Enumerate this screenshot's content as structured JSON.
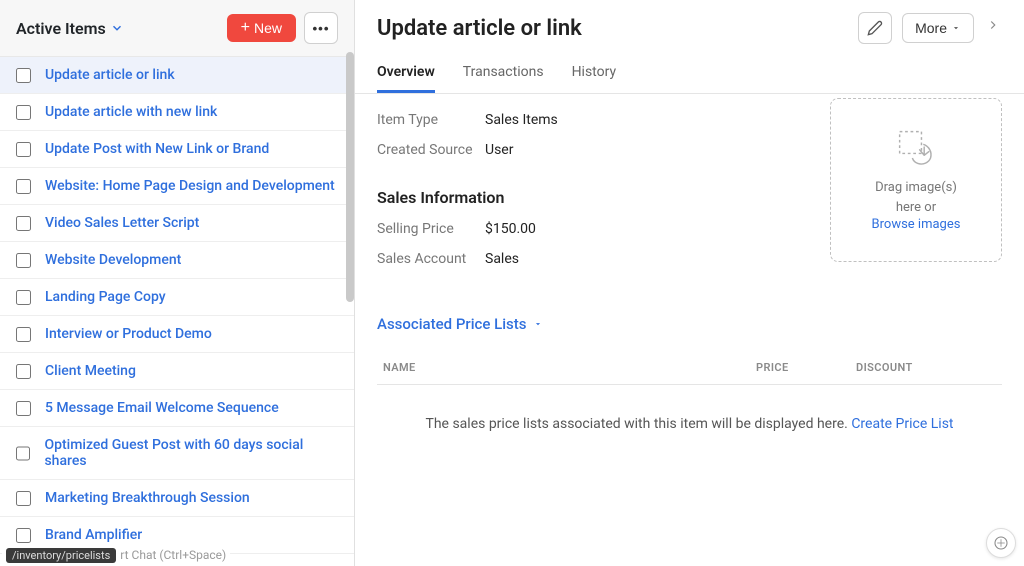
{
  "sidebar": {
    "filter_label": "Active Items",
    "new_button": "New",
    "items": [
      "Update article or link",
      "Update article with new link",
      "Update Post with New Link or Brand",
      "Website: Home Page Design and Development",
      "Video Sales Letter Script",
      "Website Development",
      "Landing Page Copy",
      "Interview or Product Demo",
      "Client Meeting",
      "5 Message Email Welcome Sequence",
      "Optimized Guest Post with 60 days social shares",
      "Marketing Breakthrough Session",
      "Brand Amplifier"
    ],
    "selected_index": 0
  },
  "header": {
    "title": "Update article or link",
    "more_label": "More"
  },
  "tabs": {
    "items": [
      "Overview",
      "Transactions",
      "History"
    ],
    "active_index": 0
  },
  "overview": {
    "item_type_label": "Item Type",
    "item_type_value": "Sales Items",
    "created_source_label": "Created Source",
    "created_source_value": "User",
    "sales_info_title": "Sales Information",
    "selling_price_label": "Selling Price",
    "selling_price_value": "$150.00",
    "sales_account_label": "Sales Account",
    "sales_account_value": "Sales"
  },
  "dropzone": {
    "line1": "Drag image(s)",
    "line2": "here or",
    "browse": "Browse images"
  },
  "price_lists": {
    "section_title": "Associated Price Lists",
    "col_name": "NAME",
    "col_price": "PRICE",
    "col_discount": "DISCOUNT",
    "empty_text": "The sales price lists associated with this item will be displayed here. ",
    "create_link": "Create Price List"
  },
  "footer": {
    "path": "/inventory/pricelists",
    "chat_hint": "rt Chat (Ctrl+Space)"
  }
}
